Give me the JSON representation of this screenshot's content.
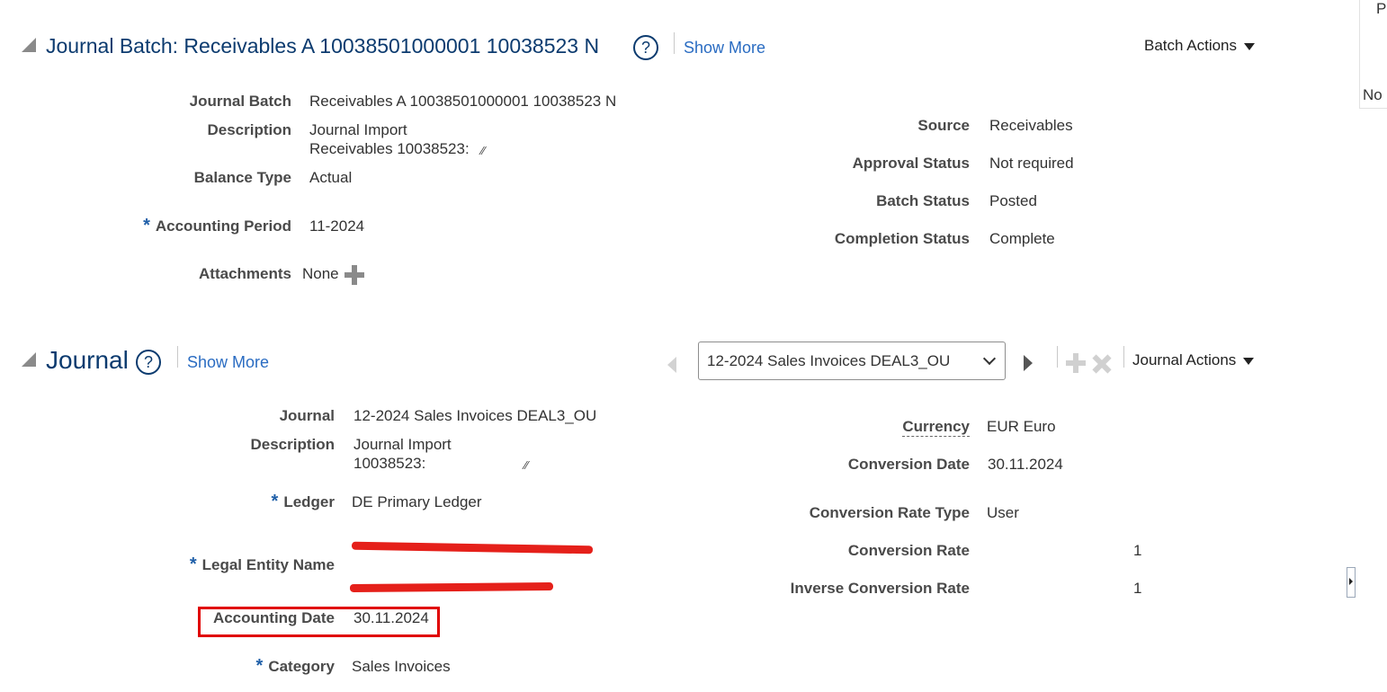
{
  "right_panel": {
    "top_letter": "P",
    "value": "No"
  },
  "batch_section": {
    "title": "Journal Batch: Receivables A 10038501000001 10038523 N",
    "help_icon": "?",
    "show_more": "Show More",
    "actions": "Batch Actions",
    "left_fields": {
      "journal_batch": {
        "label": "Journal Batch",
        "value": "Receivables A 10038501000001 10038523 N"
      },
      "description": {
        "label": "Description",
        "line1": "Journal Import",
        "line2": "Receivables 10038523:"
      },
      "balance_type": {
        "label": "Balance Type",
        "value": "Actual"
      },
      "accounting_period": {
        "label": "Accounting Period",
        "value": "11-2024",
        "required_mark": "*"
      },
      "attachments": {
        "label": "Attachments",
        "value": "None"
      }
    },
    "right_fields": {
      "source": {
        "label": "Source",
        "value": "Receivables"
      },
      "approval_status": {
        "label": "Approval Status",
        "value": "Not required"
      },
      "batch_status": {
        "label": "Batch Status",
        "value": "Posted"
      },
      "completion_status": {
        "label": "Completion Status",
        "value": "Complete"
      }
    }
  },
  "journal_section": {
    "title": "Journal",
    "help_icon": "?",
    "show_more": "Show More",
    "selector_value": "12-2024 Sales Invoices DEAL3_OU",
    "actions": "Journal Actions",
    "left_fields": {
      "journal": {
        "label": "Journal",
        "value": "12-2024 Sales Invoices DEAL3_OU"
      },
      "description": {
        "label": "Description",
        "line1": "Journal Import",
        "line2": "10038523:"
      },
      "ledger": {
        "label": "Ledger",
        "value": "DE Primary Ledger",
        "required_mark": "*"
      },
      "legal_entity_name": {
        "label": "Legal Entity Name",
        "required_mark": "*"
      },
      "accounting_date": {
        "label": "Accounting Date",
        "value": "30.11.2024"
      },
      "category": {
        "label": "Category",
        "value": "Sales Invoices",
        "required_mark": "*"
      }
    },
    "right_fields": {
      "currency": {
        "label": "Currency",
        "value": "EUR Euro"
      },
      "conversion_date": {
        "label": "Conversion Date",
        "value": "30.11.2024"
      },
      "conversion_rate_type": {
        "label": "Conversion Rate Type",
        "value": "User"
      },
      "conversion_rate": {
        "label": "Conversion Rate",
        "value": "1"
      },
      "inverse_conversion_rate": {
        "label": "Inverse Conversion Rate",
        "value": "1"
      }
    }
  },
  "colors": {
    "title": "#0c3b6f",
    "link": "#2a6cc2",
    "required": "#1f5fa8",
    "highlight": "#e00000"
  }
}
